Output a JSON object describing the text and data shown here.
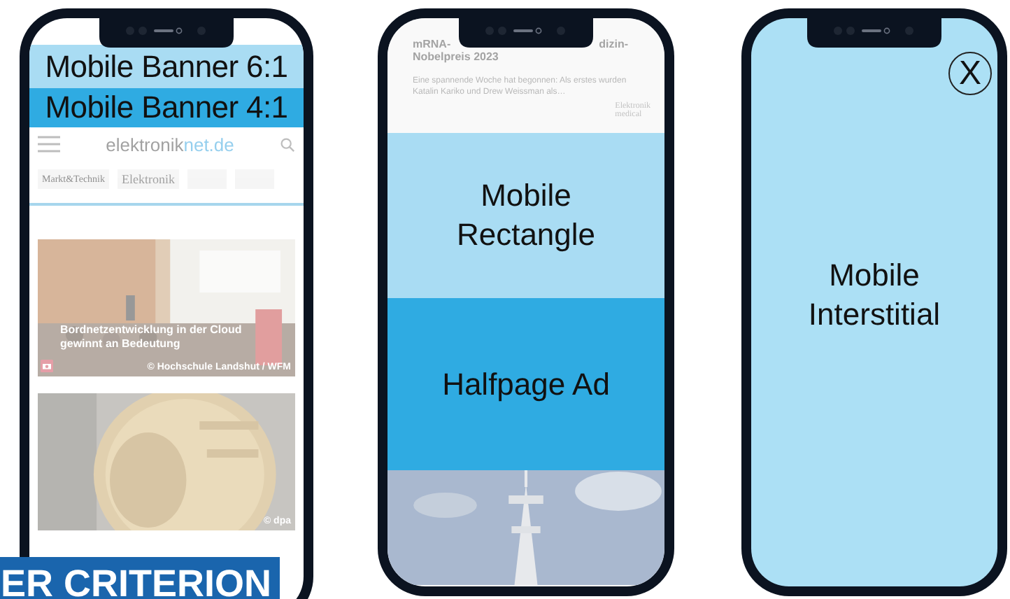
{
  "phones": [
    {
      "kind": "banner-page",
      "banners": [
        {
          "label": "Mobile Banner 6:1",
          "color": "#a9dcf3"
        },
        {
          "label": "Mobile Banner 4:1",
          "color": "#2fabe2"
        }
      ],
      "site": {
        "logo_main": "elektronik",
        "logo_accent": "net.de"
      },
      "brands": [
        "Markt&Technik",
        "Elektronik"
      ],
      "articles": [
        {
          "kind": "picture",
          "headline": "Bordnetzentwicklung in der Cloud gewinnt an Bedeutung",
          "credit": "© Hochschule Landshut / WFM"
        },
        {
          "kind": "picture",
          "credit": "© dpa"
        }
      ]
    },
    {
      "kind": "ad-stack",
      "article": {
        "headline_start": "mRNA-",
        "headline_end": "dizin-",
        "headline_line2": "Nobelpreis 2023",
        "teaser": "Eine spannende Woche hat begonnen: Als erstes wurden Katalin Karikо und Drew Weissman als…",
        "brand": "Elektronik",
        "brand_sub": "medical"
      },
      "ads": [
        {
          "label": "Mobile Rectangle",
          "color": "#a9dcf3"
        },
        {
          "label": "Halfpage Ad",
          "color": "#2fabe2"
        }
      ]
    },
    {
      "kind": "interstitial",
      "label": "Mobile Interstitial",
      "close": "X"
    }
  ],
  "criterion_label": "ER CRITERION"
}
